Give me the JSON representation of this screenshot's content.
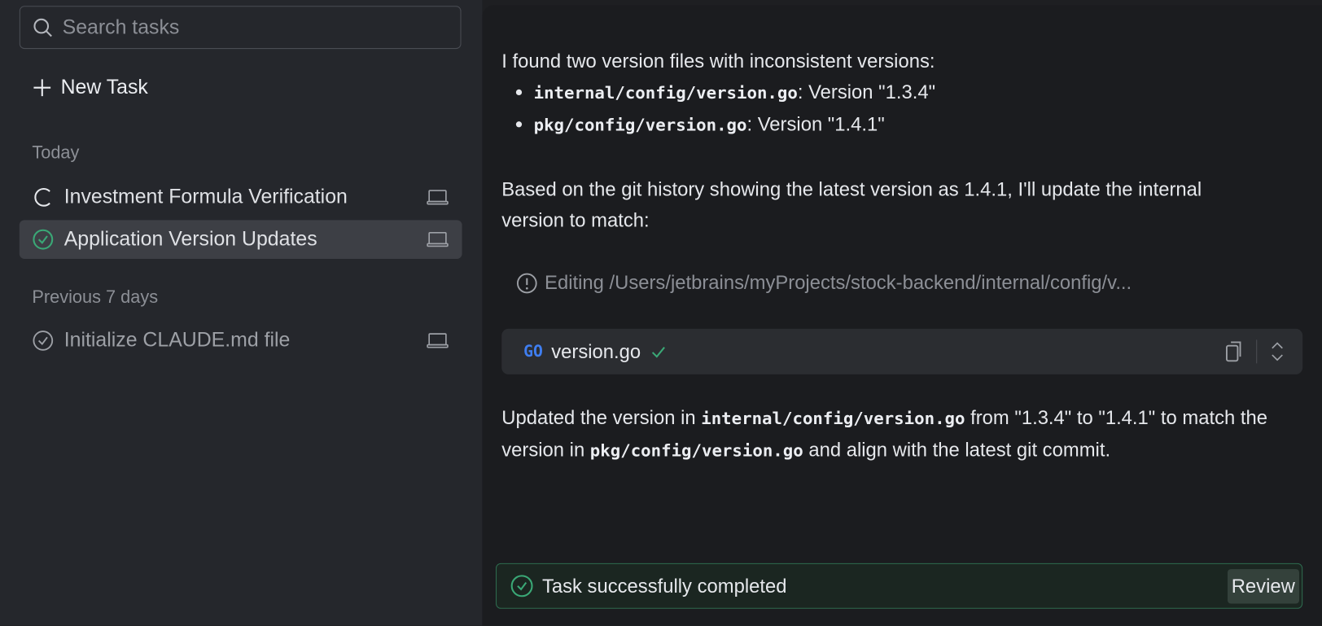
{
  "sidebar": {
    "search_placeholder": "Search tasks",
    "new_task_label": "New Task",
    "sections": [
      {
        "title": "Today",
        "items": [
          {
            "label": "Investment Formula Verification",
            "status": "in-progress"
          },
          {
            "label": "Application Version Updates",
            "status": "completed",
            "selected": true
          }
        ]
      },
      {
        "title": "Previous 7 days",
        "items": [
          {
            "label": "Initialize CLAUDE.md file",
            "status": "completed"
          }
        ]
      }
    ]
  },
  "main": {
    "intro": "I found two version files with inconsistent versions:",
    "bullets": [
      {
        "path": "internal/config/version.go",
        "text": ": Version \"1.3.4\""
      },
      {
        "path": "pkg/config/version.go",
        "text": ": Version \"1.4.1\""
      }
    ],
    "paragraph": "Based on the git history showing the latest version as 1.4.1, I'll update the internal version to match:",
    "editing": "Editing /Users/jetbrains/myProjects/stock-backend/internal/config/v...",
    "code_block": {
      "lang_badge": "GO",
      "filename": "version.go"
    },
    "summary": {
      "p1": "Updated the version in ",
      "code1": "internal/config/version.go",
      "p2": " from \"1.3.4\" to \"1.4.1\" to match the version in ",
      "code2": "pkg/config/version.go",
      "p3": " and align with the latest git commit."
    },
    "status": {
      "message": "Task successfully completed",
      "review_label": "Review"
    }
  },
  "colors": {
    "success": "#3aa876",
    "go_blue": "#3f7ef0"
  }
}
